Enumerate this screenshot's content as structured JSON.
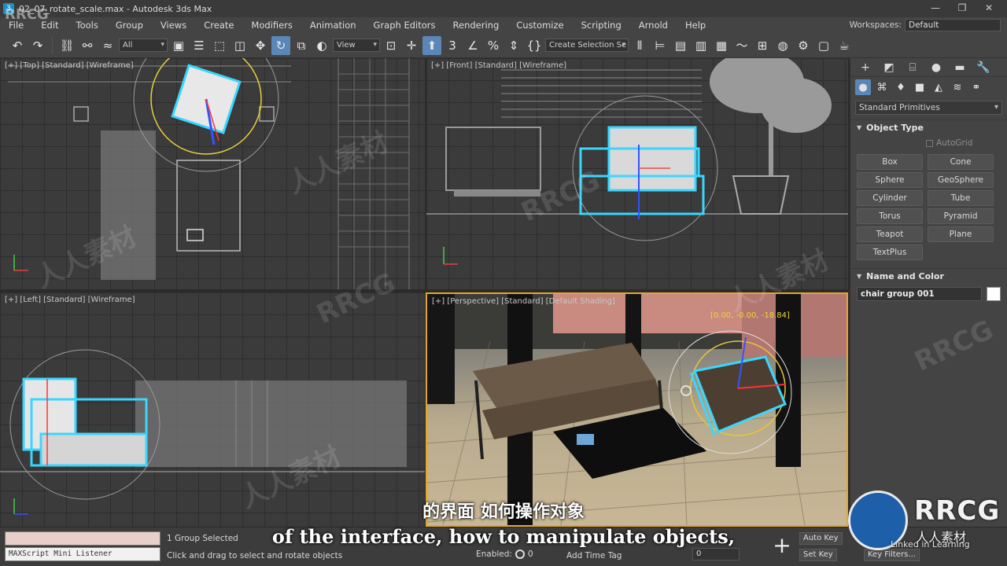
{
  "titlebar": {
    "title": "02_07_rotate_scale.max - Autodesk 3ds Max",
    "minimize": "—",
    "restore": "❐",
    "close": "✕"
  },
  "menu": [
    "File",
    "Edit",
    "Tools",
    "Group",
    "Views",
    "Create",
    "Modifiers",
    "Animation",
    "Graph Editors",
    "Rendering",
    "Customize",
    "Scripting",
    "Arnold",
    "Help"
  ],
  "workspaces": {
    "label": "Workspaces:",
    "value": "Default"
  },
  "toolbar": {
    "filter_value": "All",
    "refcoord_value": "View",
    "selection_set_value": "Create Selection Se"
  },
  "viewports": {
    "top": "[+] [Top] [Standard] [Wireframe]",
    "front": "[+] [Front] [Standard] [Wireframe]",
    "left": "[+] [Left] [Standard] [Wireframe]",
    "perspective": "[+] [Perspective] [Standard] [Default Shading]",
    "rotation_readout": "[0.00, -0.00, -18.84]"
  },
  "command_panel": {
    "category": "Standard Primitives",
    "object_type_title": "Object Type",
    "autogrid": "AutoGrid",
    "primitives": [
      "Box",
      "Cone",
      "Sphere",
      "GeoSphere",
      "Cylinder",
      "Tube",
      "Torus",
      "Pyramid",
      "Teapot",
      "Plane",
      "TextPlus"
    ],
    "name_color_title": "Name and Color",
    "object_name": "chair group 001",
    "object_color": "#ffffff"
  },
  "status": {
    "listener_label": "MAXScript Mini Listener",
    "selection": "1 Group Selected",
    "prompt": "Click and drag to select and rotate objects",
    "enabled_label": "Enabled:",
    "enabled_value": "0",
    "add_time_tag": "Add Time Tag",
    "frame_value": "0",
    "auto_key": "Auto Key",
    "set_key": "Set Key",
    "key_filters": "Key Filters..."
  },
  "subtitles": {
    "chinese": "的界面 如何操作对象",
    "english": "of the interface, how to manipulate objects,"
  },
  "watermark": {
    "brand": "RRCG",
    "chinese": "人人素材",
    "logo_text": "RRCG",
    "logo_sub": "人人素材",
    "linkedin": "Linked in Learning"
  }
}
